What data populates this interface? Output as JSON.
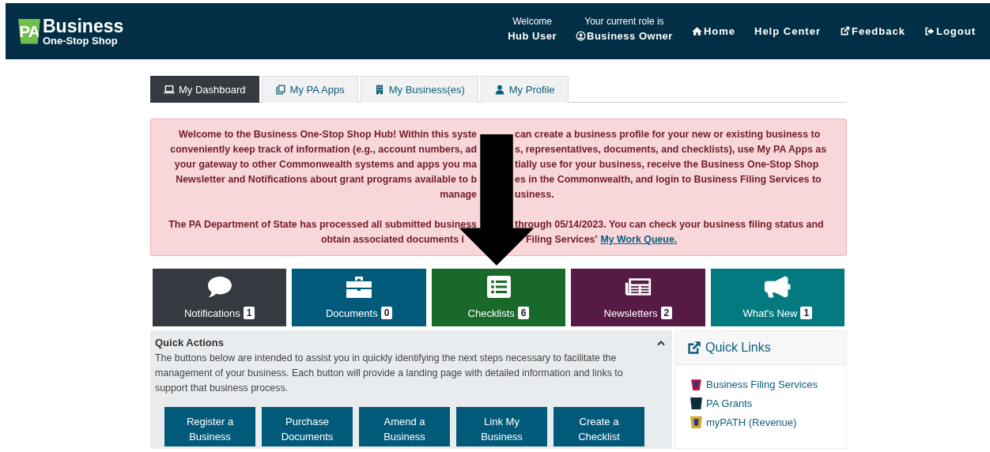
{
  "header": {
    "logo_badge": "PA",
    "logo_title": "Business",
    "logo_subtitle": "One-Stop Shop",
    "welcome_label": "Welcome",
    "welcome_user": "Hub User",
    "role_label": "Your current role is",
    "role_value": "Business Owner",
    "nav": [
      {
        "kind": "home",
        "label": "Home"
      },
      {
        "kind": "plain",
        "label": "Help Center"
      },
      {
        "kind": "feedback",
        "label": "Feedback"
      },
      {
        "kind": "logout",
        "label": "Logout"
      }
    ]
  },
  "tabs": [
    {
      "kind": "laptop",
      "label": "My Dashboard",
      "selected": true
    },
    {
      "kind": "copy",
      "label": "My PA Apps",
      "selected": false
    },
    {
      "kind": "building",
      "label": "My Business(es)",
      "selected": false
    },
    {
      "kind": "user",
      "label": "My Profile",
      "selected": false
    }
  ],
  "alert": {
    "paragraphs": [
      {
        "lines": [
          {
            "left": "Welcome to the Business One-Stop Shop Hub! Within this syste",
            "right": "can create a business profile for your new or existing business to"
          },
          {
            "left": "conveniently keep track of information (e.g., account numbers, ad",
            "right": "s, representatives, documents, and checklists), use My PA Apps as"
          },
          {
            "left": "your gateway to other Commonwealth systems and apps you ma",
            "right": "tially use for your business, receive the Business One-Stop Shop"
          },
          {
            "left": "Newsletter and Notifications about grant programs available to b",
            "right": "es in the Commonwealth, and login to Business Filing Services to"
          },
          {
            "left": "manage",
            "right": "usiness."
          }
        ]
      },
      {
        "lines": [
          {
            "left": "The PA Department of State has processed all submitted business",
            "right": "through 05/14/2023. You can check your business filing status and"
          },
          {
            "left": "obtain associated documents i",
            "right": "Filing Services'"
          }
        ]
      }
    ],
    "link": "My Work Queue."
  },
  "tiles": [
    {
      "kind": "chat",
      "label": "Notifications",
      "count": "1",
      "color": "#343a40"
    },
    {
      "kind": "briefcase",
      "label": "Documents",
      "count": "0",
      "color": "#025a7b"
    },
    {
      "kind": "list",
      "label": "Checklists",
      "count": "6",
      "color": "#196a2a"
    },
    {
      "kind": "newspaper",
      "label": "Newsletters",
      "count": "2",
      "color": "#561a45"
    },
    {
      "kind": "megaphone",
      "label": "What's New",
      "count": "1",
      "color": "#037a80"
    }
  ],
  "quick_actions": {
    "title": "Quick Actions",
    "expanded": true,
    "description": "The buttons below are intended to assist you in quickly identifying the next steps necessary to facilitate the management of your business. Each button will provide a landing page with detailed information and links to support that business process.",
    "buttons": [
      [
        "Register a",
        "Business"
      ],
      [
        "Purchase",
        "Documents"
      ],
      [
        "Amend a",
        "Business"
      ],
      [
        "Link My",
        "Business"
      ],
      [
        "Create a",
        "Checklist"
      ]
    ]
  },
  "quick_links": {
    "title": "Quick Links",
    "items": [
      {
        "kind": "filing",
        "label": "Business Filing Services"
      },
      {
        "kind": "pa",
        "label": "PA Grants"
      },
      {
        "kind": "revenue",
        "label": "myPATH (Revenue)"
      }
    ]
  }
}
